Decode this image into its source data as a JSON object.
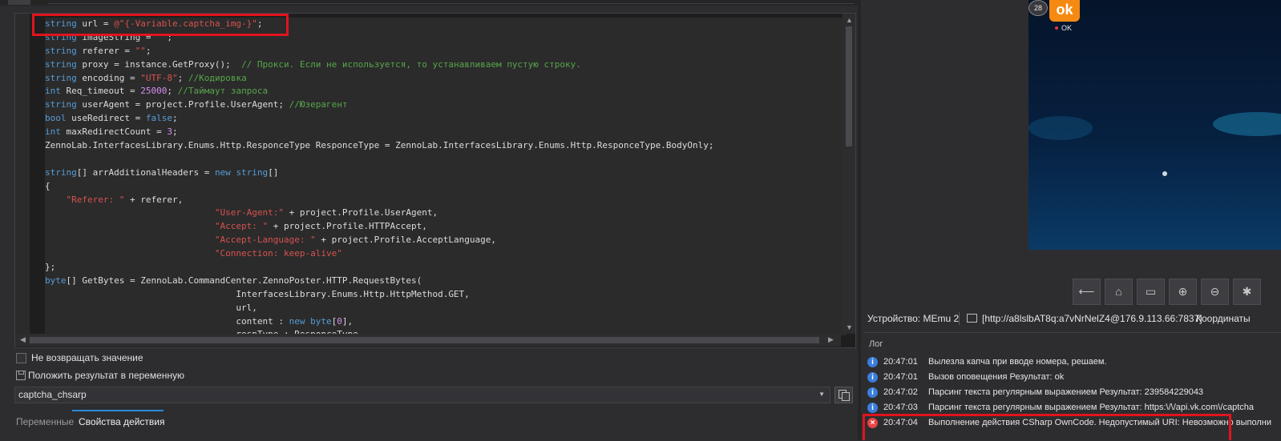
{
  "editor": {
    "lines": [
      [
        {
          "c": "ty",
          "t": "string"
        },
        {
          "c": "id",
          "t": " url = "
        },
        {
          "c": "st",
          "t": "@\"{-Variable.captcha_img-}\""
        },
        {
          "c": "id",
          "t": ";"
        }
      ],
      [
        {
          "c": "ty",
          "t": "string"
        },
        {
          "c": "id",
          "t": " imageString = "
        },
        {
          "c": "st",
          "t": "\"\""
        },
        {
          "c": "id",
          "t": ";"
        }
      ],
      [
        {
          "c": "ty",
          "t": "string"
        },
        {
          "c": "id",
          "t": " referer = "
        },
        {
          "c": "st",
          "t": "\"\""
        },
        {
          "c": "id",
          "t": ";"
        }
      ],
      [
        {
          "c": "ty",
          "t": "string"
        },
        {
          "c": "id",
          "t": " proxy = instance.GetProxy();  "
        },
        {
          "c": "cm",
          "t": "// Прокси. Если не используется, то устанавливаем пустую строку."
        }
      ],
      [
        {
          "c": "ty",
          "t": "string"
        },
        {
          "c": "id",
          "t": " encoding = "
        },
        {
          "c": "st",
          "t": "\"UTF-8\""
        },
        {
          "c": "id",
          "t": "; "
        },
        {
          "c": "cm",
          "t": "//Кодировка"
        }
      ],
      [
        {
          "c": "ty",
          "t": "int"
        },
        {
          "c": "id",
          "t": " Req_timeout = "
        },
        {
          "c": "nm",
          "t": "25000"
        },
        {
          "c": "id",
          "t": "; "
        },
        {
          "c": "cm",
          "t": "//Таймаут запроса"
        }
      ],
      [
        {
          "c": "ty",
          "t": "string"
        },
        {
          "c": "id",
          "t": " userAgent = project.Profile.UserAgent; "
        },
        {
          "c": "cm",
          "t": "//Юзерагент"
        }
      ],
      [
        {
          "c": "ty",
          "t": "bool"
        },
        {
          "c": "id",
          "t": " useRedirect = "
        },
        {
          "c": "kw",
          "t": "false"
        },
        {
          "c": "id",
          "t": ";"
        }
      ],
      [
        {
          "c": "ty",
          "t": "int"
        },
        {
          "c": "id",
          "t": " maxRedirectCount = "
        },
        {
          "c": "nm",
          "t": "3"
        },
        {
          "c": "id",
          "t": ";"
        }
      ],
      [
        {
          "c": "id",
          "t": "ZennoLab.InterfacesLibrary.Enums.Http.ResponceType ResponceType = ZennoLab.InterfacesLibrary.Enums.Http.ResponceType.BodyOnly;"
        }
      ],
      [
        {
          "c": "id",
          "t": ""
        }
      ],
      [
        {
          "c": "ty",
          "t": "string"
        },
        {
          "c": "id",
          "t": "[] arrAdditionalHeaders = "
        },
        {
          "c": "kw",
          "t": "new"
        },
        {
          "c": "id",
          "t": " "
        },
        {
          "c": "ty",
          "t": "string"
        },
        {
          "c": "id",
          "t": "[]"
        }
      ],
      [
        {
          "c": "id",
          "t": "{"
        }
      ],
      [
        {
          "c": "id",
          "t": "    "
        },
        {
          "c": "st",
          "t": "\"Referer: \""
        },
        {
          "c": "id",
          "t": " + referer,"
        }
      ],
      [
        {
          "c": "id",
          "t": "                                "
        },
        {
          "c": "st",
          "t": "\"User-Agent:\""
        },
        {
          "c": "id",
          "t": " + project.Profile.UserAgent,"
        }
      ],
      [
        {
          "c": "id",
          "t": "                                "
        },
        {
          "c": "st",
          "t": "\"Accept: \""
        },
        {
          "c": "id",
          "t": " + project.Profile.HTTPAccept,"
        }
      ],
      [
        {
          "c": "id",
          "t": "                                "
        },
        {
          "c": "st",
          "t": "\"Accept-Language: \""
        },
        {
          "c": "id",
          "t": " + project.Profile.AcceptLanguage,"
        }
      ],
      [
        {
          "c": "id",
          "t": "                                "
        },
        {
          "c": "st",
          "t": "\"Connection: keep-alive\""
        }
      ],
      [
        {
          "c": "id",
          "t": "};"
        }
      ],
      [
        {
          "c": "ty",
          "t": "byte"
        },
        {
          "c": "id",
          "t": "[] GetBytes = ZennoLab.CommandCenter.ZennoPoster.HTTP.RequestBytes("
        }
      ],
      [
        {
          "c": "id",
          "t": "                                    InterfacesLibrary.Enums.Http.HttpMethod.GET,"
        }
      ],
      [
        {
          "c": "id",
          "t": "                                    url,"
        }
      ],
      [
        {
          "c": "id",
          "t": "                                    content : "
        },
        {
          "c": "kw",
          "t": "new"
        },
        {
          "c": "id",
          "t": " "
        },
        {
          "c": "ty",
          "t": "byte"
        },
        {
          "c": "id",
          "t": "["
        },
        {
          "c": "nm",
          "t": "0"
        },
        {
          "c": "id",
          "t": "],"
        }
      ],
      [
        {
          "c": "id",
          "t": "                                    respType : ResponceType,"
        }
      ]
    ],
    "colors": {
      "type": "#569cd6",
      "string": "#d7524f",
      "comment": "#57a64a",
      "number": "#d48ff0",
      "highlight_box": "#e0141e"
    }
  },
  "options": {
    "no_return_label": "Не возвращать значение",
    "put_result_label": "Положить результат в переменную",
    "variable_value": "captcha_chsarp"
  },
  "tabs": {
    "variables": "Переменные",
    "action_properties": "Свойства действия",
    "active_color": "#2a8bd8"
  },
  "device": {
    "notif_count": "28",
    "ok_logo": "ok",
    "ok_label": "OK",
    "toolbar_icons": [
      "back-icon",
      "home-icon",
      "recent-apps-icon",
      "zoom-in-icon",
      "zoom-out-icon",
      "settings-icon"
    ]
  },
  "status": {
    "device": "Устройство: MEmu 2",
    "proxy": "[http://a8lslbAT8q:a7vNrNelZ4@176.9.113.66:7837]",
    "coords": "Координаты"
  },
  "log": {
    "title": "Лог",
    "entries": [
      {
        "type": "info",
        "time": "20:47:01",
        "msg": "Вылезла капча при вводе номера, решаем."
      },
      {
        "type": "info",
        "time": "20:47:01",
        "msg": "Вызов оповещения  Результат: ok"
      },
      {
        "type": "info",
        "time": "20:47:02",
        "msg": "Парсинг текста регулярным выражением  Результат: 239584229043"
      },
      {
        "type": "info",
        "time": "20:47:03",
        "msg": "Парсинг текста регулярным выражением  Результат: https:\\/\\/api.vk.com\\/captcha"
      },
      {
        "type": "error",
        "time": "20:47:04",
        "msg": "Выполнение действия CSharp OwnCode. Недопустимый URI: Невозможно выполни"
      }
    ],
    "colors": {
      "info": "#3b7ddd",
      "error": "#e84545"
    }
  }
}
